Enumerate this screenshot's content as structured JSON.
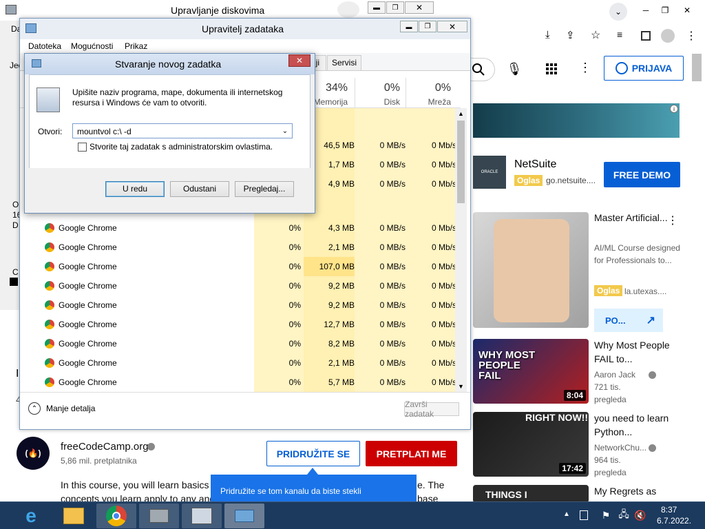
{
  "disk_mgmt": {
    "title": "Upravljanje diskovima",
    "side_labels": [
      "Da",
      "Jed",
      "O",
      "16",
      "D",
      "C"
    ]
  },
  "browser": {
    "login_label": "PRIJAVA",
    "ad": {
      "brand": "NetSuite",
      "badge": "Oglas",
      "domain": "go.netsuite....",
      "cta": "FREE DEMO"
    },
    "videos": [
      {
        "title": "Master Artificial...",
        "line2": "AI/ML Course designed for Professionals to...",
        "badge": "Oglas",
        "channel": "la.utexas....",
        "cta": "PO..."
      },
      {
        "title": "Why Most People FAIL to...",
        "channel": "Aaron Jack",
        "views": "721 tis. pregleda",
        "duration": "8:04",
        "thumb_text": "WHY MOST PEOPLE FAIL"
      },
      {
        "title": "you need to learn Python...",
        "channel": "NetworkChu...",
        "views": "964 tis. pregleda",
        "duration": "17:42",
        "thumb_text": "RIGHT NOW!!"
      },
      {
        "title": "My Regrets as",
        "thumb_text": "THINGS I"
      }
    ],
    "channel": {
      "name": "freeCodeCamp.org",
      "subs": "5,86 mil. pretplatnika",
      "join": "PRIDRUŽITE SE",
      "subscribe": "PRETPLATI ME"
    },
    "description": "In this course, you will learn basics",
    "description2": "concepts you learn apply to any and",
    "description_tail1": "e. The",
    "description_tail2": "base",
    "tooltip": "Pridružite se tom kanalu da biste stekli",
    "left_glyphs": [
      "I",
      "4"
    ]
  },
  "task_manager": {
    "title": "Upravitelj zadataka",
    "menu": [
      "Datoteka",
      "Mogućnosti",
      "Prikaz"
    ],
    "tab_partial": "lji",
    "tab_services": "Servisi",
    "columns": {
      "memory_pct": "34%",
      "memory": "Memorija",
      "disk_pct": "0%",
      "disk": "Disk",
      "net_pct": "0%",
      "net": "Mreža"
    },
    "top_rows": [
      {
        "mem": "46,5 MB",
        "disk": "0 MB/s",
        "net": "0 Mb/s"
      },
      {
        "mem": "1,7 MB",
        "disk": "0 MB/s",
        "net": "0 Mb/s"
      },
      {
        "mem": "4,9 MB",
        "disk": "0 MB/s",
        "net": "0 Mb/s"
      }
    ],
    "processes": [
      {
        "name": "Google Chrome",
        "cpu": "0%",
        "mem": "4,3 MB",
        "disk": "0 MB/s",
        "net": "0 Mb/s"
      },
      {
        "name": "Google Chrome",
        "cpu": "0%",
        "mem": "2,1 MB",
        "disk": "0 MB/s",
        "net": "0 Mb/s"
      },
      {
        "name": "Google Chrome",
        "cpu": "0%",
        "mem": "107,0 MB",
        "disk": "0 MB/s",
        "net": "0 Mb/s"
      },
      {
        "name": "Google Chrome",
        "cpu": "0%",
        "mem": "9,2 MB",
        "disk": "0 MB/s",
        "net": "0 Mb/s"
      },
      {
        "name": "Google Chrome",
        "cpu": "0%",
        "mem": "9,2 MB",
        "disk": "0 MB/s",
        "net": "0 Mb/s"
      },
      {
        "name": "Google Chrome",
        "cpu": "0%",
        "mem": "12,7 MB",
        "disk": "0 MB/s",
        "net": "0 Mb/s"
      },
      {
        "name": "Google Chrome",
        "cpu": "0%",
        "mem": "8,2 MB",
        "disk": "0 MB/s",
        "net": "0 Mb/s"
      },
      {
        "name": "Google Chrome",
        "cpu": "0%",
        "mem": "2,1 MB",
        "disk": "0 MB/s",
        "net": "0 Mb/s"
      },
      {
        "name": "Google Chrome",
        "cpu": "0%",
        "mem": "5,7 MB",
        "disk": "0 MB/s",
        "net": "0 Mb/s"
      }
    ],
    "fewer_details": "Manje detalja",
    "end_task": "Završi zadatak"
  },
  "run_dialog": {
    "title": "Stvaranje novog zadatka",
    "description": "Upišite naziv programa, mape, dokumenta ili internetskog resursa i Windows će vam to otvoriti.",
    "open_label": "Otvori:",
    "open_value": "mountvol c:\\ -d",
    "admin_checkbox": "Stvorite taj zadatak s administratorskim ovlastima.",
    "ok": "U redu",
    "cancel": "Odustani",
    "browse": "Pregledaj..."
  },
  "taskbar": {
    "time": "8:37",
    "date": "6.7.2022."
  },
  "colors": {
    "accent": "#065fd4",
    "red": "#cc0000",
    "taskbar": "#1c3a5e"
  }
}
